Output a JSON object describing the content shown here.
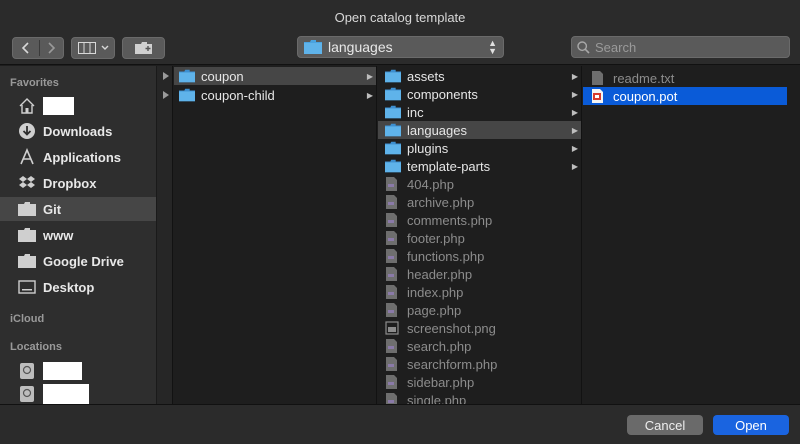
{
  "window": {
    "title": "Open catalog template"
  },
  "toolbar": {
    "back_icon": "chevron-left-icon",
    "forward_icon": "chevron-right-icon",
    "view_icon": "column-view-icon",
    "new_folder_icon": "new-folder-icon",
    "path": {
      "value": "languages"
    },
    "search": {
      "placeholder": "Search"
    }
  },
  "sidebar": {
    "favorites_header": "Favorites",
    "favorites": [
      {
        "label": "",
        "icon": "home-icon",
        "redacted": true
      },
      {
        "label": "Downloads",
        "icon": "downloads-icon"
      },
      {
        "label": "Applications",
        "icon": "applications-icon"
      },
      {
        "label": "Dropbox",
        "icon": "dropbox-icon"
      },
      {
        "label": "Git",
        "icon": "folder-icon",
        "selected": true
      },
      {
        "label": "www",
        "icon": "folder-icon"
      },
      {
        "label": "Google Drive",
        "icon": "folder-icon"
      },
      {
        "label": "Desktop",
        "icon": "desktop-icon"
      }
    ],
    "icloud_header": "iCloud",
    "locations_header": "Locations",
    "locations": [
      {
        "label": "",
        "icon": "disk-icon",
        "redacted": true
      },
      {
        "label": "",
        "icon": "disk-icon",
        "redacted": true
      }
    ]
  },
  "columns": {
    "col1": [
      {
        "name": "coupon",
        "type": "folder",
        "selected": true
      },
      {
        "name": "coupon-child",
        "type": "folder"
      }
    ],
    "col2": [
      {
        "name": "assets",
        "type": "folder"
      },
      {
        "name": "components",
        "type": "folder"
      },
      {
        "name": "inc",
        "type": "folder"
      },
      {
        "name": "languages",
        "type": "folder",
        "selected": true
      },
      {
        "name": "plugins",
        "type": "folder"
      },
      {
        "name": "template-parts",
        "type": "folder"
      },
      {
        "name": "404.php",
        "type": "file"
      },
      {
        "name": "archive.php",
        "type": "file"
      },
      {
        "name": "comments.php",
        "type": "file"
      },
      {
        "name": "footer.php",
        "type": "file"
      },
      {
        "name": "functions.php",
        "type": "file"
      },
      {
        "name": "header.php",
        "type": "file"
      },
      {
        "name": "index.php",
        "type": "file"
      },
      {
        "name": "page.php",
        "type": "file"
      },
      {
        "name": "screenshot.png",
        "type": "image"
      },
      {
        "name": "search.php",
        "type": "file"
      },
      {
        "name": "searchform.php",
        "type": "file"
      },
      {
        "name": "sidebar.php",
        "type": "file"
      },
      {
        "name": "single.php",
        "type": "file"
      }
    ],
    "col3": [
      {
        "name": "readme.txt",
        "type": "text"
      },
      {
        "name": "coupon.pot",
        "type": "pot",
        "selected": true
      }
    ]
  },
  "footer": {
    "cancel_label": "Cancel",
    "open_label": "Open"
  },
  "colors": {
    "accent": "#1a64e0",
    "folder": "#4aa3e0",
    "selection": "#0a5bd8"
  }
}
